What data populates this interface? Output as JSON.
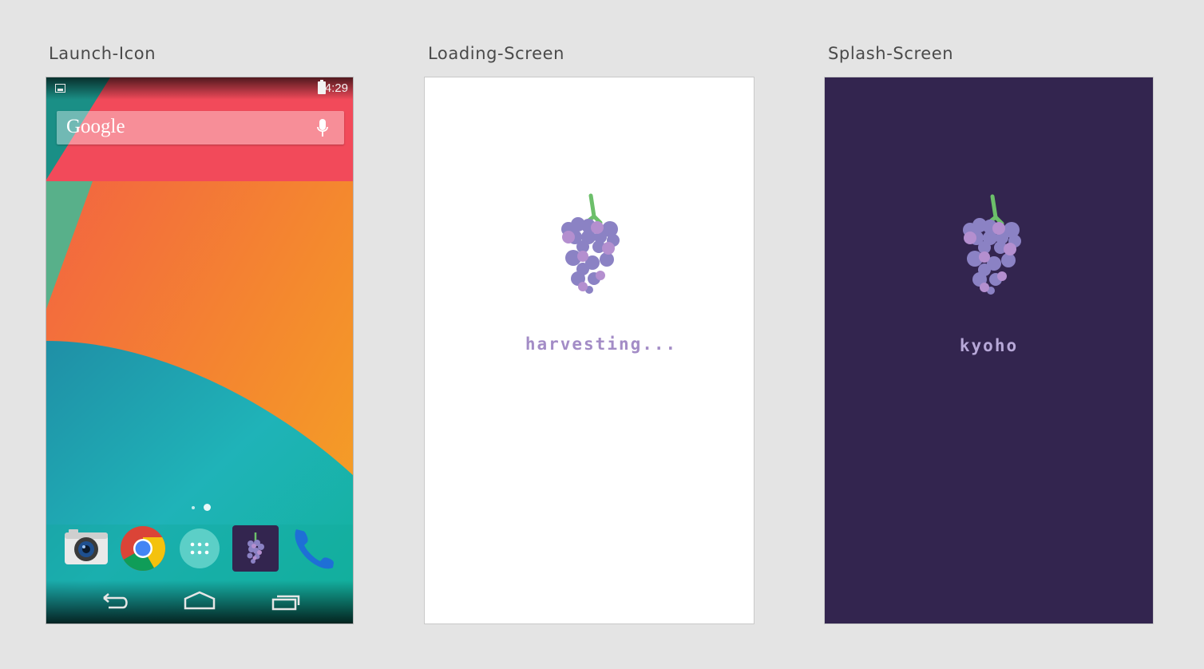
{
  "artboards": {
    "launch": {
      "label": "Launch-Icon",
      "status_time": "4:29",
      "search_brand": "Google",
      "dock_apps": [
        "camera-icon",
        "chrome-icon",
        "app-drawer-icon",
        "kyoho-app-icon",
        "phone-icon"
      ],
      "nav_buttons": [
        "back-icon",
        "home-icon",
        "recents-icon"
      ]
    },
    "loading": {
      "label": "Loading-Screen",
      "text": "harvesting..."
    },
    "splash": {
      "label": "Splash-Screen",
      "text": "kyoho"
    }
  },
  "colors": {
    "canvas": "#e4e4e4",
    "splash_background": "#33254f",
    "grape_purple": "#8b82c4",
    "grape_pink": "#b48fcf",
    "stem_green": "#6cbf6a",
    "loading_text": "#a38cc6",
    "splash_text": "#b7a8d8"
  }
}
